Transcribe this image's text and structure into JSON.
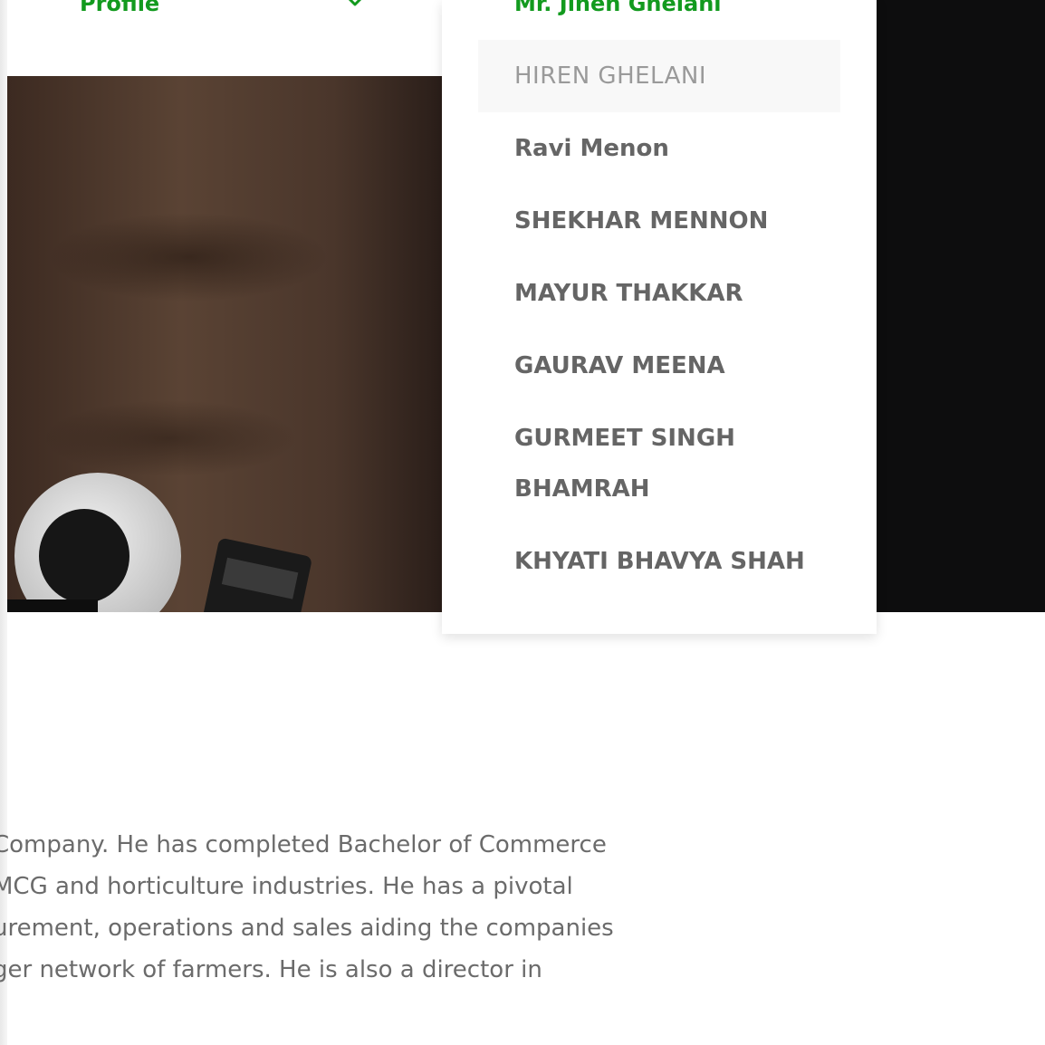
{
  "nav": {
    "profile_label": "Profile"
  },
  "dropdown": {
    "header": "Mr. Jinen Ghelani",
    "items": [
      {
        "label": "HIREN GHELANI",
        "active": true
      },
      {
        "label": "Ravi Menon",
        "active": false
      },
      {
        "label": "SHEKHAR MENNON",
        "active": false
      },
      {
        "label": "MAYUR THAKKAR",
        "active": false
      },
      {
        "label": "GAURAV MEENA",
        "active": false
      },
      {
        "label": "GURMEET SINGH",
        "active": false
      },
      {
        "label": "BHAMRAH",
        "active": false
      },
      {
        "label": "KHYATI BHAVYA SHAH",
        "active": false
      }
    ]
  },
  "bio": {
    "lines": [
      " Company. He has completed Bachelor of Commerce",
      " MCG and  horticulture industries. He has a pivotal",
      "urement, operations and sales aiding the  companies",
      "ger network of farmers. He is also a director in"
    ]
  },
  "colors": {
    "accent": "#129a1e",
    "menu_text": "#656565",
    "active_text": "#9a9a9a",
    "active_bg": "#f8f8f8",
    "body_text": "#6b6b6b"
  }
}
